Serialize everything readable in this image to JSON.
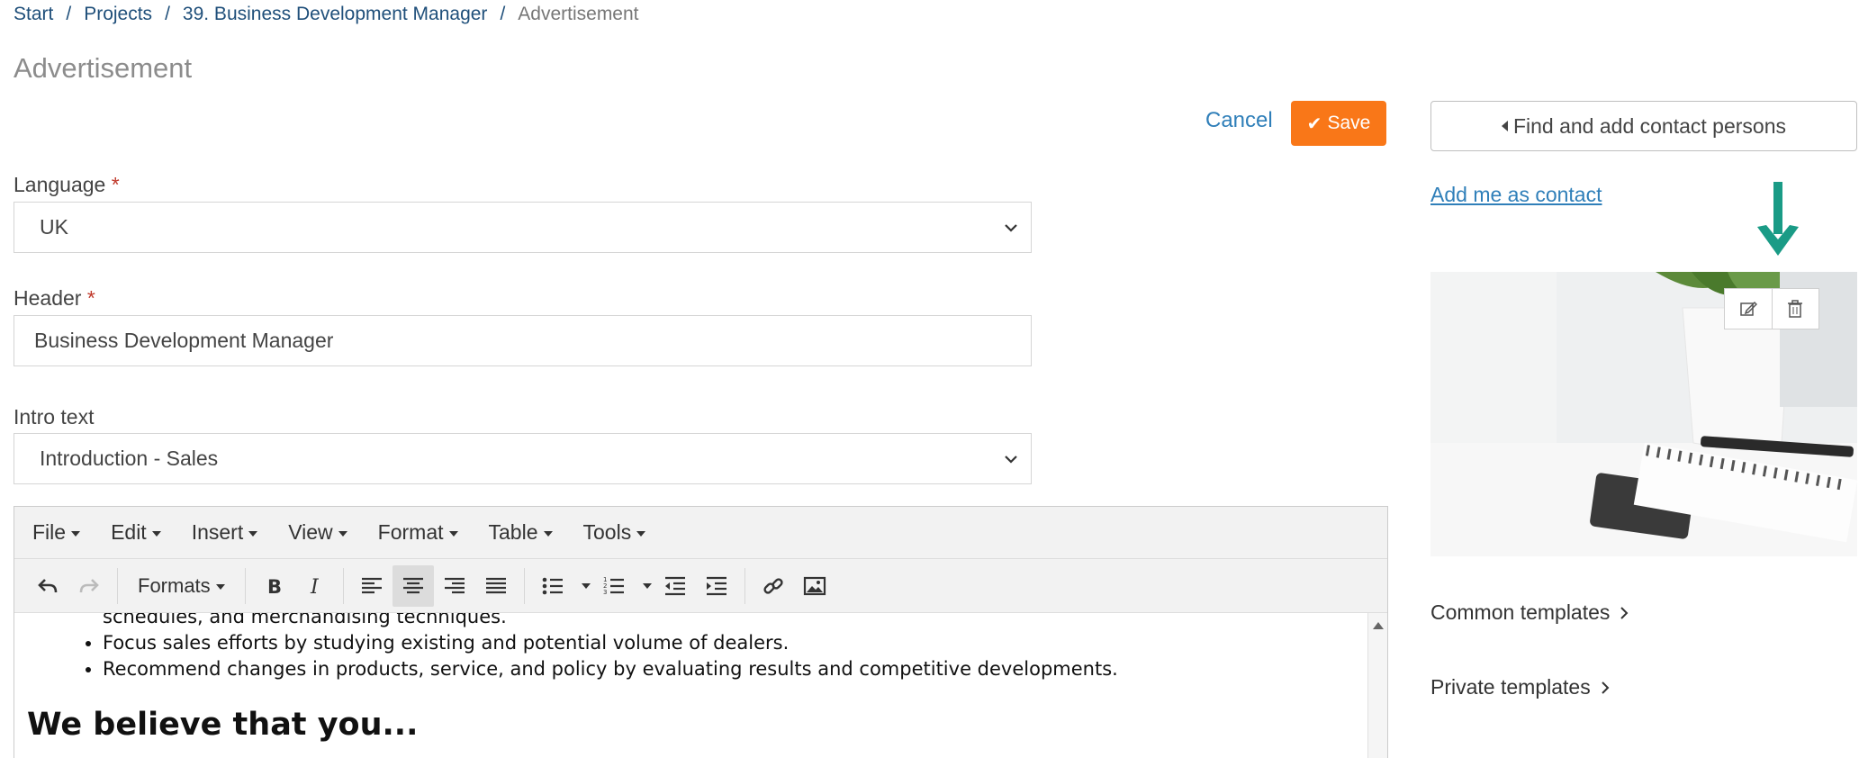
{
  "breadcrumb": {
    "items": [
      "Start",
      "Projects",
      "39. Business Development Manager"
    ],
    "separator": "/",
    "current": "Advertisement"
  },
  "page": {
    "title": "Advertisement"
  },
  "actions": {
    "cancel_label": "Cancel",
    "save_label": "Save"
  },
  "form": {
    "language": {
      "label": "Language",
      "required_mark": "*",
      "value": "UK"
    },
    "header": {
      "label": "Header",
      "required_mark": "*",
      "value": "Business Development Manager"
    },
    "intro": {
      "label": "Intro text",
      "value": "Introduction - Sales"
    }
  },
  "editor": {
    "menus": [
      "File",
      "Edit",
      "Insert",
      "View",
      "Format",
      "Table",
      "Tools"
    ],
    "formats_label": "Formats",
    "toolbar_icons": [
      "undo-icon",
      "redo-icon",
      "bold-icon",
      "italic-icon",
      "align-left-icon",
      "align-center-icon",
      "align-right-icon",
      "justify-icon",
      "bullet-list-icon",
      "numbered-list-icon",
      "outdent-icon",
      "indent-icon",
      "link-icon",
      "image-icon"
    ],
    "active_alignment": "align-center",
    "content": {
      "bullets": [
        "schedules, and merchandising techniques.",
        "Focus sales efforts by studying existing and potential volume of dealers.",
        "Recommend changes in products, service, and policy by evaluating results and competitive developments."
      ],
      "heading": "We believe that you..."
    }
  },
  "sidebar": {
    "find_contacts_label": "Find and add contact persons",
    "add_me_label": "Add me as contact",
    "templates": {
      "common_label": "Common templates",
      "private_label": "Private templates"
    }
  },
  "colors": {
    "accent_orange": "#f97718",
    "link_blue": "#2f7fb9",
    "breadcrumb_blue": "#1f4f7a",
    "arrow_teal": "#1a9b86"
  }
}
